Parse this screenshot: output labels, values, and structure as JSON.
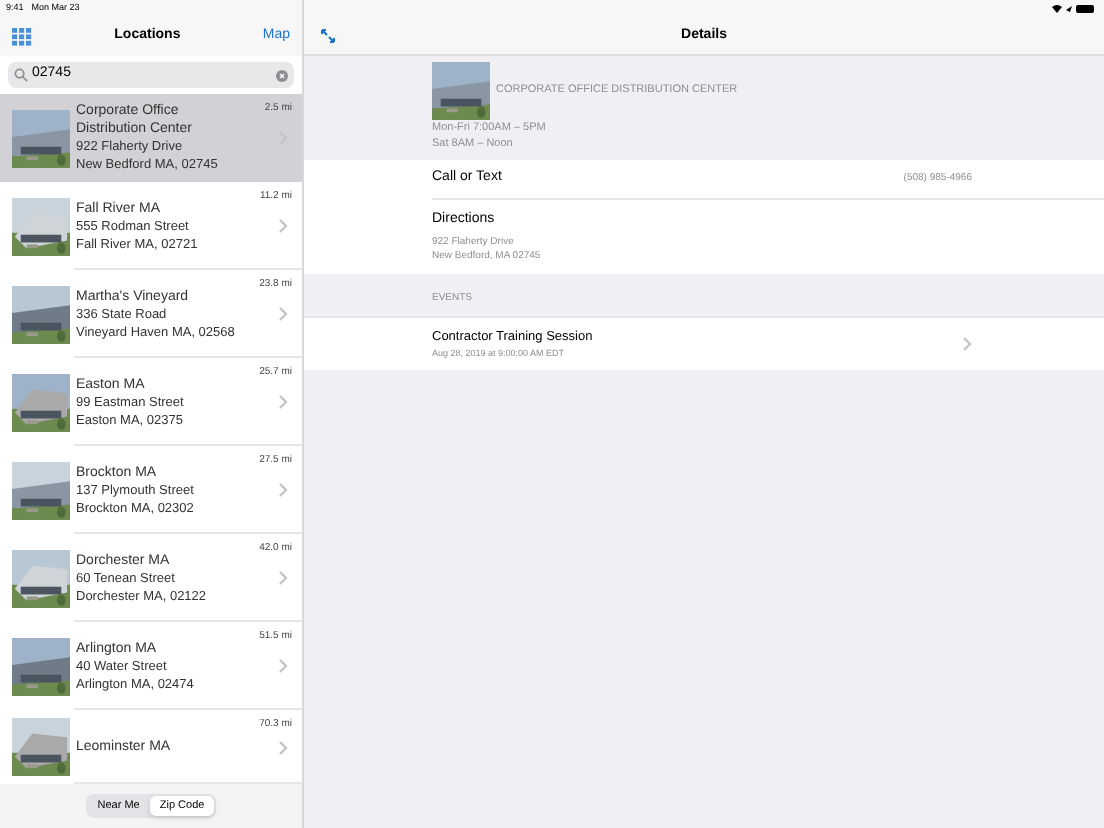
{
  "status_bar": {
    "time": "9:41",
    "date": "Mon Mar 23"
  },
  "sidebar": {
    "title": "Locations",
    "map_link": "Map",
    "search": {
      "value": "02745"
    },
    "locations": [
      {
        "name": "Corporate Office Distribution Center",
        "street": "922 Flaherty Drive",
        "city": "New Bedford MA, 02745",
        "distance": "2.5 mi",
        "selected": true
      },
      {
        "name": "Fall River MA",
        "street": "555 Rodman Street",
        "city": "Fall River MA, 02721",
        "distance": "11.2 mi",
        "selected": false
      },
      {
        "name": "Martha's Vineyard",
        "street": "336 State Road",
        "city": "Vineyard Haven MA, 02568",
        "distance": "23.8 mi",
        "selected": false
      },
      {
        "name": "Easton MA",
        "street": "99 Eastman Street",
        "city": "Easton MA, 02375",
        "distance": "25.7 mi",
        "selected": false
      },
      {
        "name": "Brockton MA",
        "street": "137 Plymouth Street",
        "city": "Brockton MA, 02302",
        "distance": "27.5 mi",
        "selected": false
      },
      {
        "name": "Dorchester MA",
        "street": "60 Tenean Street",
        "city": "Dorchester MA, 02122",
        "distance": "42.0 mi",
        "selected": false
      },
      {
        "name": "Arlington MA",
        "street": "40 Water Street",
        "city": "Arlington MA, 02474",
        "distance": "51.5 mi",
        "selected": false
      },
      {
        "name": "Leominster MA",
        "distance": "70.3 mi",
        "selected": false
      }
    ],
    "segments": [
      {
        "label": "Near Me",
        "selected": false
      },
      {
        "label": "Zip Code",
        "selected": true
      }
    ]
  },
  "details": {
    "title": "Details",
    "name": "CORPORATE OFFICE DISTRIBUTION CENTER",
    "hours": [
      "Mon-Fri 7:00AM – 5PM",
      "Sat 8AM – Noon"
    ],
    "call_label": "Call or Text",
    "phone": "(508) 985-4966",
    "directions_label": "Directions",
    "address": [
      "922 Flaherty Drive",
      "New Bedford, MA 02745"
    ],
    "events_header": "EVENTS",
    "events": [
      {
        "title": "Contractor Training Session",
        "date": "Aug 28, 2019 at 9:00:00 AM EDT"
      }
    ]
  }
}
